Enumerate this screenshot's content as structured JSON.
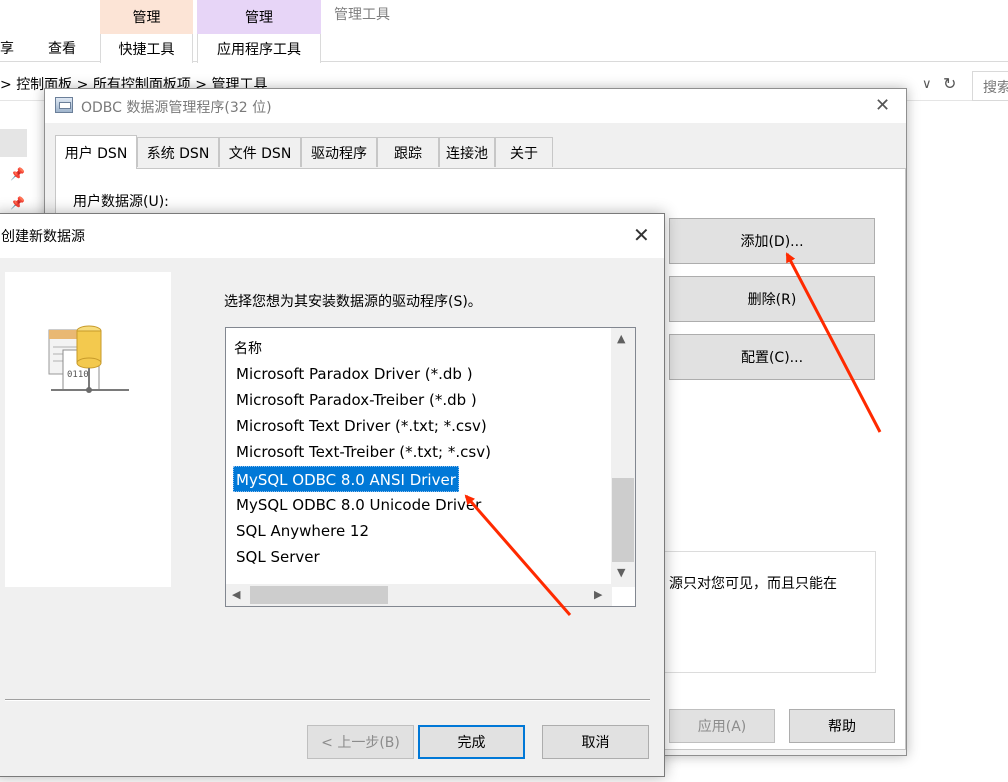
{
  "explorer": {
    "ribbon_context_tab_1": "管理",
    "ribbon_context_tab_2": "管理",
    "ribbon_context_title": "管理工具",
    "ribbon_tabs": [
      "享",
      "查看",
      "快捷工具",
      "应用程序工具"
    ],
    "breadcrumb": [
      "控制面板",
      "所有控制面板项",
      "管理工具"
    ],
    "search_placeholder": "搜索"
  },
  "odbc_window": {
    "title": "ODBC 数据源管理程序(32 位)",
    "tabs": [
      "用户 DSN",
      "系统 DSN",
      "文件 DSN",
      "驱动程序",
      "跟踪",
      "连接池",
      "关于"
    ],
    "selected_tab": "用户 DSN",
    "user_data_sources_label": "用户数据源(U):",
    "add_button": "添加(D)...",
    "delete_button": "删除(R)",
    "configure_button": "配置(C)...",
    "description_text": "源只对您可见，而且只能在",
    "apply_button": "应用(A)",
    "help_button": "帮助"
  },
  "create_dialog": {
    "title": "创建新数据源",
    "prompt": "选择您想为其安装数据源的驱动程序(S)。",
    "column_header": "名称",
    "drivers": [
      "Microsoft Paradox Driver (*.db )",
      "Microsoft Paradox-Treiber (*.db )",
      "Microsoft Text Driver (*.txt; *.csv)",
      "Microsoft Text-Treiber (*.txt; *.csv)",
      "MySQL ODBC 8.0 ANSI Driver",
      "MySQL ODBC 8.0 Unicode Driver",
      "SQL Anywhere 12",
      "SQL Server"
    ],
    "selected_driver": "MySQL ODBC 8.0 ANSI Driver",
    "back_button": "< 上一步(B)",
    "finish_button": "完成",
    "cancel_button": "取消"
  },
  "colors": {
    "selection_blue": "#0078d7",
    "annotation_red": "#ff2a00",
    "context_tab_orange": "#fce4d6",
    "context_tab_purple": "#e7d5f7"
  }
}
